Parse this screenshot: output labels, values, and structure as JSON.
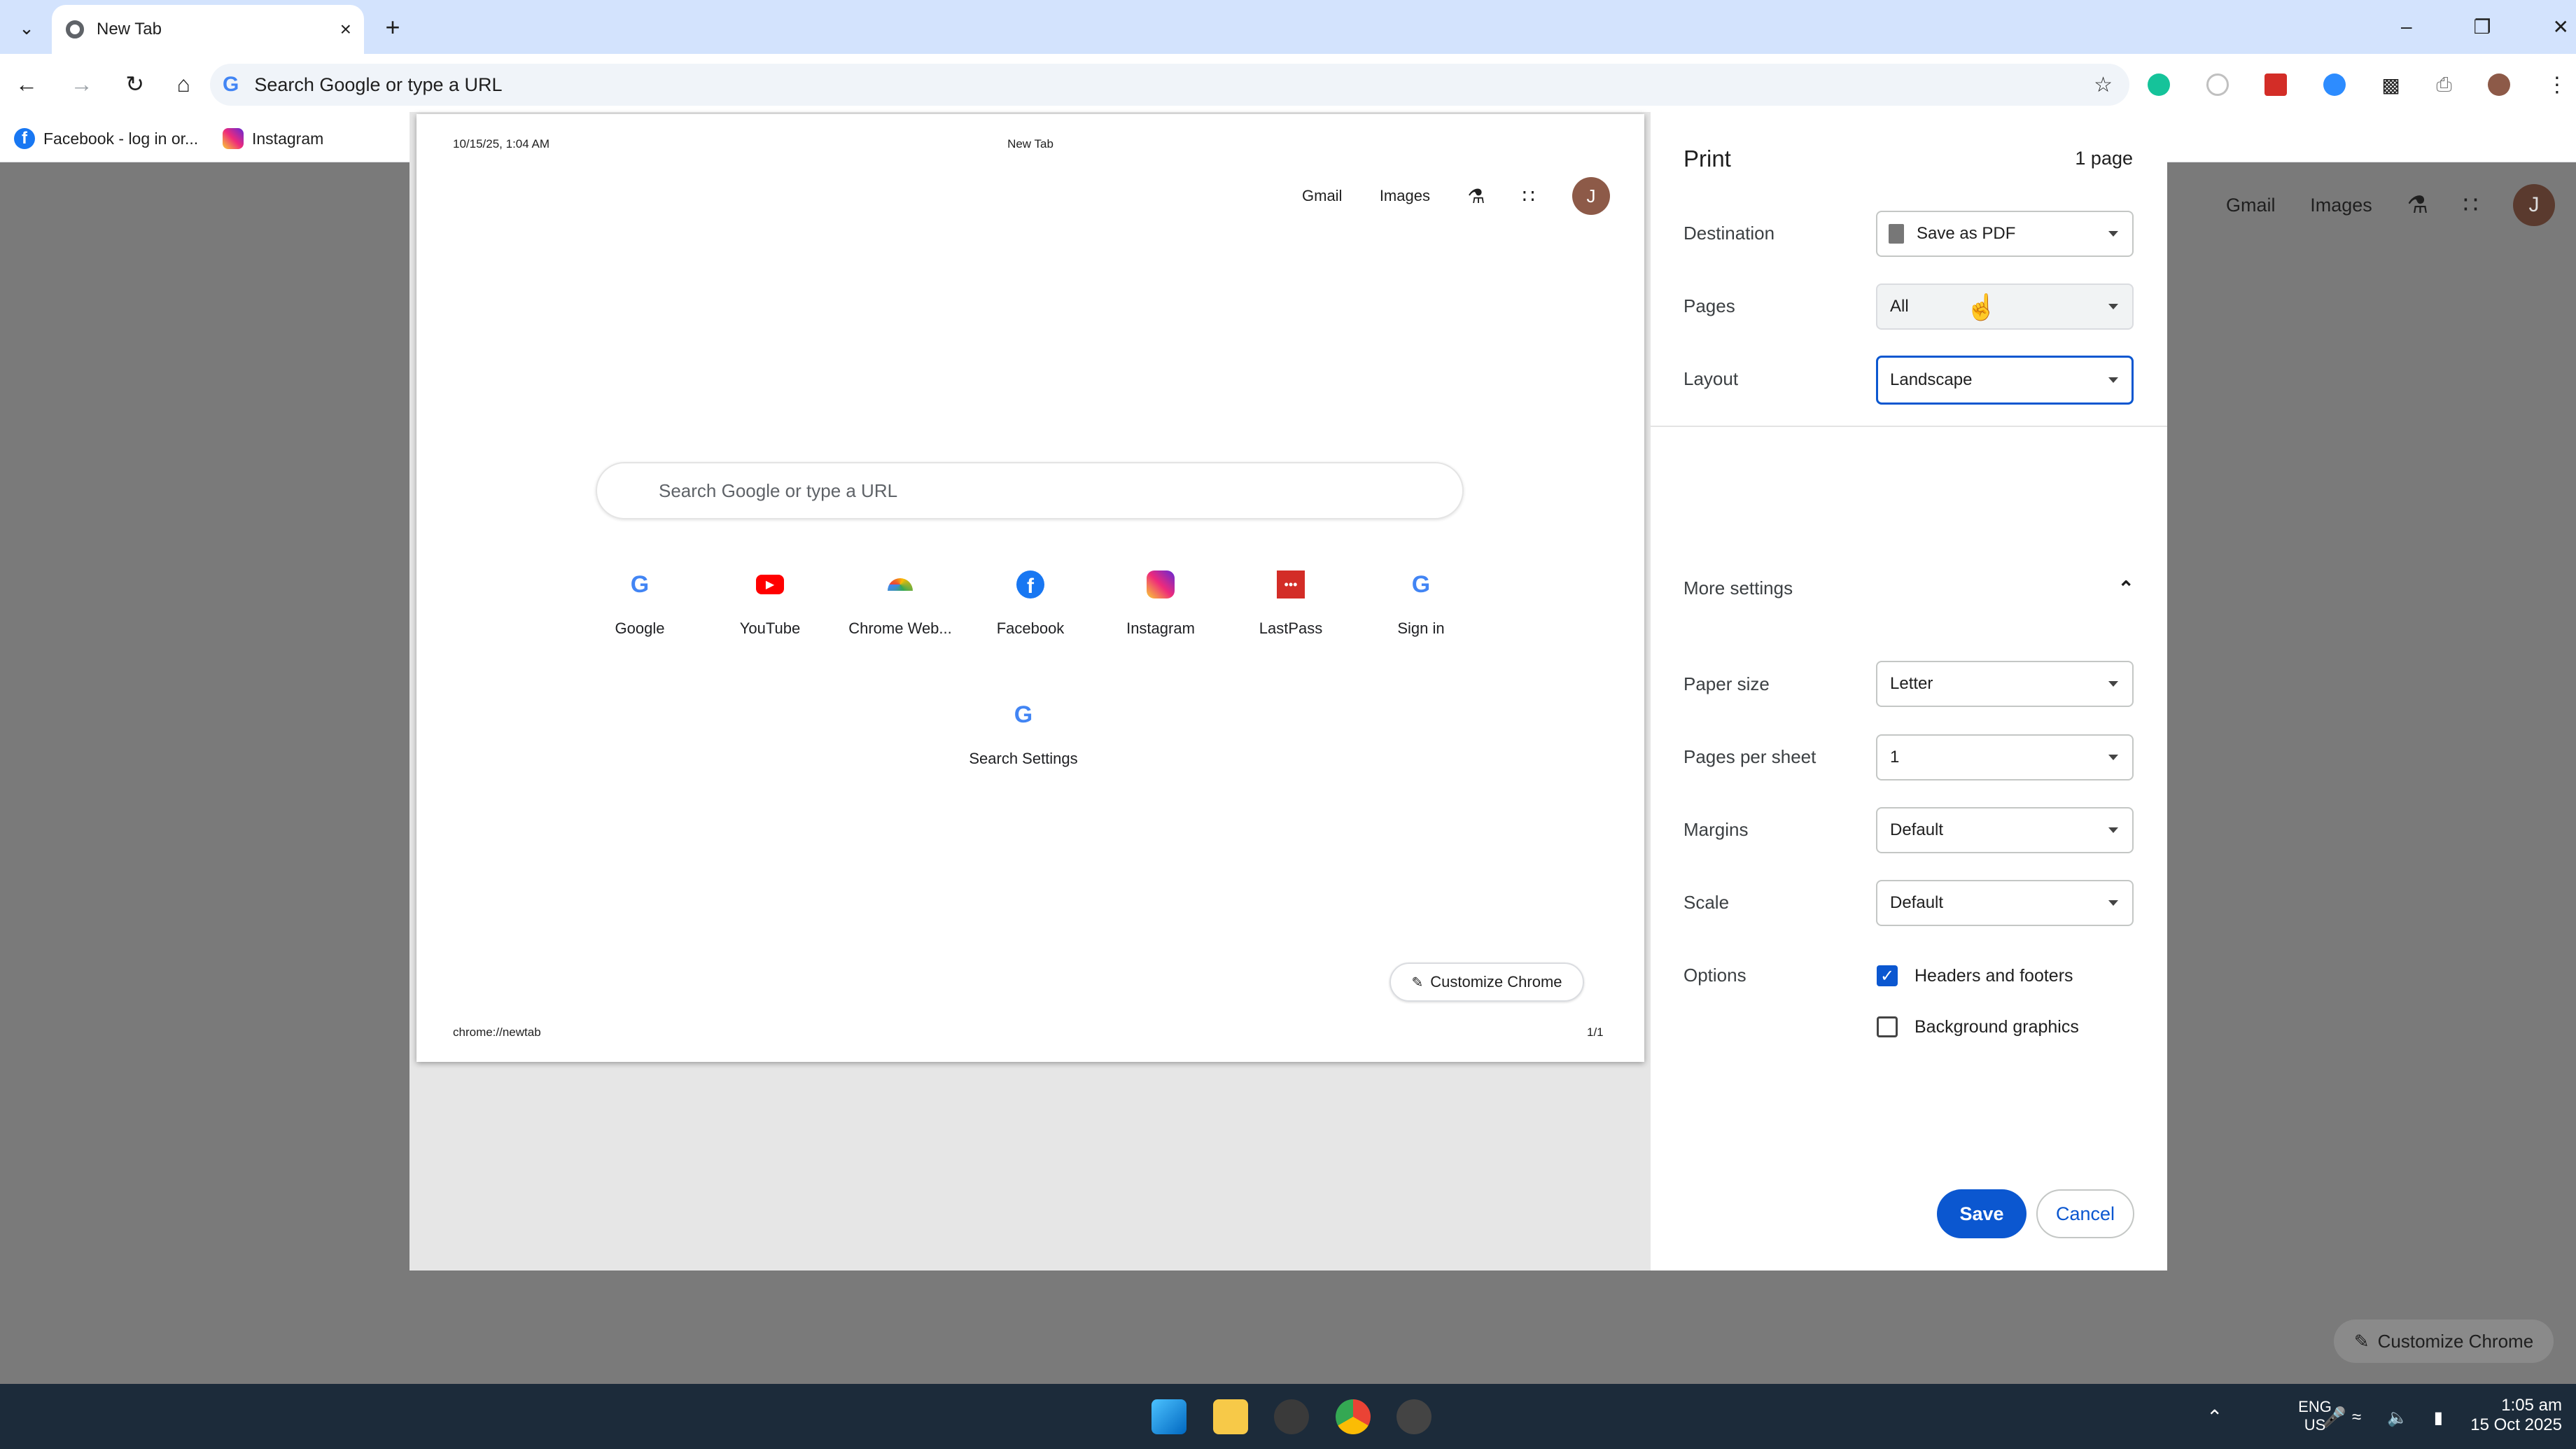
{
  "browser": {
    "tab_title": "New Tab",
    "omnibox_placeholder": "Search Google or type a URL",
    "bookmarks": [
      {
        "label": "Facebook - log in or..."
      },
      {
        "label": "Instagram"
      }
    ]
  },
  "background_page": {
    "links": [
      "Gmail",
      "Images"
    ],
    "avatar": "J",
    "customize_label": "Customize Chrome"
  },
  "preview": {
    "header_left": "10/15/25, 1:04 AM",
    "header_center": "New Tab",
    "footer_left": "chrome://newtab",
    "footer_right": "1/1",
    "links": [
      "Gmail",
      "Images"
    ],
    "avatar": "J",
    "search_placeholder": "Search Google or type a URL",
    "shortcuts": [
      {
        "label": "Google",
        "icon": "google-icon"
      },
      {
        "label": "YouTube",
        "icon": "youtube-icon"
      },
      {
        "label": "Chrome Web...",
        "icon": "chrome-web-store-icon"
      },
      {
        "label": "Facebook",
        "icon": "facebook-icon"
      },
      {
        "label": "Instagram",
        "icon": "instagram-icon"
      },
      {
        "label": "LastPass",
        "icon": "lastpass-icon"
      },
      {
        "label": "Sign in",
        "icon": "google-icon"
      }
    ],
    "shortcut_row2": {
      "label": "Search Settings",
      "icon": "google-icon"
    },
    "customize_label": "Customize Chrome"
  },
  "print": {
    "title": "Print",
    "page_count": "1 page",
    "destination_label": "Destination",
    "destination_value": "Save as PDF",
    "pages_label": "Pages",
    "pages_value": "All",
    "layout_label": "Layout",
    "layout_value": "Landscape",
    "more_settings": "More settings",
    "paper_size_label": "Paper size",
    "paper_size_value": "Letter",
    "pages_per_sheet_label": "Pages per sheet",
    "pages_per_sheet_value": "1",
    "margins_label": "Margins",
    "margins_value": "Default",
    "scale_label": "Scale",
    "scale_value": "Default",
    "options_label": "Options",
    "headers_footers": "Headers and footers",
    "headers_footers_checked": true,
    "background_graphics": "Background graphics",
    "background_graphics_checked": false,
    "save": "Save",
    "cancel": "Cancel"
  },
  "taskbar": {
    "lang": "ENG",
    "region": "US",
    "time": "1:05 am",
    "date": "15 Oct 2025"
  },
  "colors": {
    "accent": "#0b57d0",
    "tabstrip": "#d3e3fd",
    "taskbar": "#1c2b3a"
  }
}
